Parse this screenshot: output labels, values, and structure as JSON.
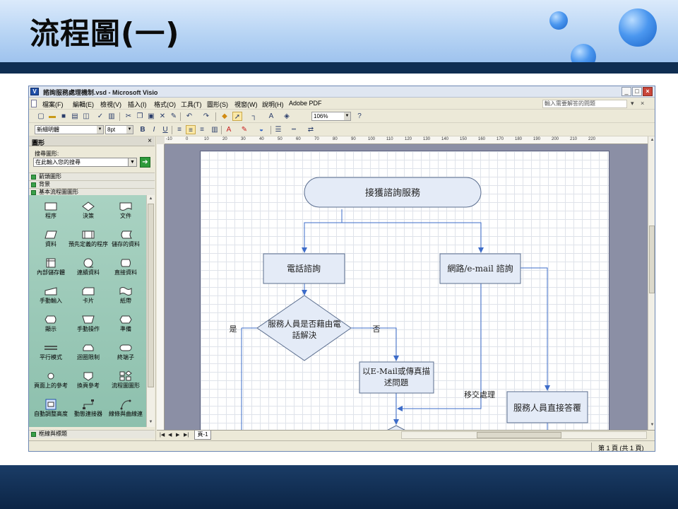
{
  "slide": {
    "title": "流程圖(一)",
    "colors": {
      "header_light": "#dbeafb",
      "header_dark_bar": "#0f2e52",
      "footer_bar": "#0c2546",
      "bubble": "#4b97ef"
    }
  },
  "window": {
    "title": "諮詢服務處理機制.vsd - Microsoft Visio",
    "controls": [
      "_",
      "□",
      "×"
    ]
  },
  "menu": {
    "items": [
      "檔案(F)",
      "編輯(E)",
      "檢視(V)",
      "插入(I)",
      "格式(O)",
      "工具(T)",
      "圖形(S)",
      "視窗(W)",
      "說明(H)",
      "Adobe PDF"
    ],
    "help_placeholder": "輸入需要解答的問題",
    "right_controls": [
      "▾",
      "×"
    ]
  },
  "toolbar": {
    "zoom": "106%",
    "font": "新細明體",
    "size": "8pt"
  },
  "shapes_pane": {
    "title": "圖形",
    "search_label": "搜尋圖形:",
    "search_placeholder": "在此輸入您的搜尋",
    "stencils": [
      "箭頭圖形",
      "背景",
      "基本流程圖圖形"
    ],
    "bottom_stencil": "框線與標題",
    "masters": [
      {
        "label": "程序",
        "icon": "process-shape-icon"
      },
      {
        "label": "決策",
        "icon": "decision-shape-icon"
      },
      {
        "label": "文件",
        "icon": "document-shape-icon"
      },
      {
        "label": "資料",
        "icon": "data-shape-icon"
      },
      {
        "label": "預先定義的程序",
        "icon": "predefined-process-icon"
      },
      {
        "label": "儲存的資料",
        "icon": "stored-data-icon"
      },
      {
        "label": "內部儲存體",
        "icon": "internal-storage-icon"
      },
      {
        "label": "連續資料",
        "icon": "sequential-data-icon"
      },
      {
        "label": "直接資料",
        "icon": "direct-data-icon"
      },
      {
        "label": "手動輸入",
        "icon": "manual-input-icon"
      },
      {
        "label": "卡片",
        "icon": "card-icon"
      },
      {
        "label": "紙帶",
        "icon": "paper-tape-icon"
      },
      {
        "label": "顯示",
        "icon": "display-icon"
      },
      {
        "label": "手動操作",
        "icon": "manual-operation-icon"
      },
      {
        "label": "準備",
        "icon": "preparation-icon"
      },
      {
        "label": "平行模式",
        "icon": "parallel-mode-icon"
      },
      {
        "label": "迴圈限制",
        "icon": "loop-limit-icon"
      },
      {
        "label": "終端子",
        "icon": "terminator-icon"
      },
      {
        "label": "頁面上的參考",
        "icon": "on-page-reference-icon"
      },
      {
        "label": "換頁參考",
        "icon": "off-page-reference-icon"
      },
      {
        "label": "流程圖圖形",
        "icon": "flowchart-shapes-icon"
      },
      {
        "label": "自動調整高度",
        "icon": "auto-height-icon"
      },
      {
        "label": "動態連接器",
        "icon": "dynamic-connector-icon"
      },
      {
        "label": "線條與曲線連",
        "icon": "line-curve-connector-icon"
      }
    ]
  },
  "rulers": {
    "top": [
      "-10",
      "0",
      "10",
      "20",
      "30",
      "40",
      "50",
      "60",
      "70",
      "80",
      "90",
      "100",
      "110",
      "120",
      "130",
      "140",
      "150",
      "160",
      "170",
      "180",
      "190",
      "200",
      "210",
      "220"
    ]
  },
  "diagram": {
    "nodes": {
      "start": "接獲諮詢服務",
      "phone": "電話諮詢",
      "web": "網路/e-mail 諮詢",
      "decision_line1": "服務人員是否藉由電",
      "decision_line2": "話解決",
      "email_line1": "以E-Mail或傳真描",
      "email_line2": "述問題",
      "direct": "服務人員直接答覆"
    },
    "labels": {
      "yes": "是",
      "no": "否",
      "transfer": "移交處理"
    },
    "colors": {
      "terminator_fill": "#e4ebf7",
      "process_fill": "#e4ebf7",
      "stroke": "#5a6d8e",
      "connector": "#3d6cc9"
    }
  },
  "tabs": {
    "page": "頁-1"
  },
  "status": {
    "page_info": "第 1 頁 (共 1 頁)"
  }
}
